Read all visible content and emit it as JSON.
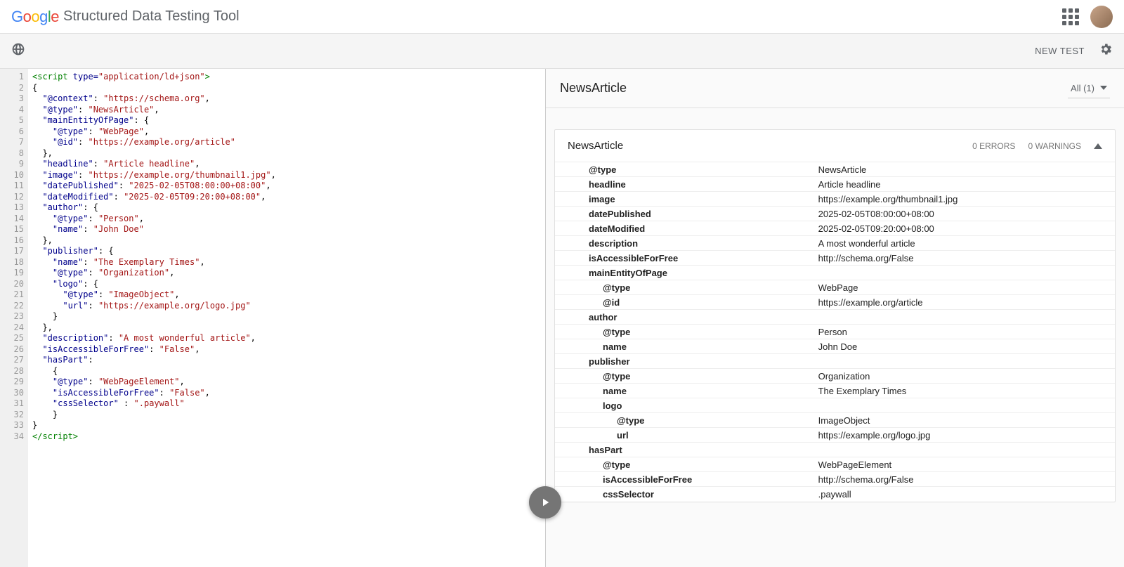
{
  "header": {
    "app_title": "Structured Data Testing Tool"
  },
  "toolbar": {
    "new_test_label": "NEW TEST"
  },
  "code": {
    "line_count": 34,
    "tokens": [
      [
        {
          "c": "t-tag",
          "t": "<script "
        },
        {
          "c": "t-attr",
          "t": "type="
        },
        {
          "c": "t-str",
          "t": "\"application/ld+json\""
        },
        {
          "c": "t-tag",
          "t": ">"
        }
      ],
      [
        {
          "c": "t-punc",
          "t": "{"
        }
      ],
      [
        {
          "c": "t-punc",
          "t": "  "
        },
        {
          "c": "t-key",
          "t": "\"@context\""
        },
        {
          "c": "t-punc",
          "t": ": "
        },
        {
          "c": "t-str",
          "t": "\"https://schema.org\""
        },
        {
          "c": "t-punc",
          "t": ","
        }
      ],
      [
        {
          "c": "t-punc",
          "t": "  "
        },
        {
          "c": "t-key",
          "t": "\"@type\""
        },
        {
          "c": "t-punc",
          "t": ": "
        },
        {
          "c": "t-str",
          "t": "\"NewsArticle\""
        },
        {
          "c": "t-punc",
          "t": ","
        }
      ],
      [
        {
          "c": "t-punc",
          "t": "  "
        },
        {
          "c": "t-key",
          "t": "\"mainEntityOfPage\""
        },
        {
          "c": "t-punc",
          "t": ": {"
        }
      ],
      [
        {
          "c": "t-punc",
          "t": "    "
        },
        {
          "c": "t-key",
          "t": "\"@type\""
        },
        {
          "c": "t-punc",
          "t": ": "
        },
        {
          "c": "t-str",
          "t": "\"WebPage\""
        },
        {
          "c": "t-punc",
          "t": ","
        }
      ],
      [
        {
          "c": "t-punc",
          "t": "    "
        },
        {
          "c": "t-key",
          "t": "\"@id\""
        },
        {
          "c": "t-punc",
          "t": ": "
        },
        {
          "c": "t-str",
          "t": "\"https://example.org/article\""
        }
      ],
      [
        {
          "c": "t-punc",
          "t": "  },"
        }
      ],
      [
        {
          "c": "t-punc",
          "t": "  "
        },
        {
          "c": "t-key",
          "t": "\"headline\""
        },
        {
          "c": "t-punc",
          "t": ": "
        },
        {
          "c": "t-str",
          "t": "\"Article headline\""
        },
        {
          "c": "t-punc",
          "t": ","
        }
      ],
      [
        {
          "c": "t-punc",
          "t": "  "
        },
        {
          "c": "t-key",
          "t": "\"image\""
        },
        {
          "c": "t-punc",
          "t": ": "
        },
        {
          "c": "t-str",
          "t": "\"https://example.org/thumbnail1.jpg\""
        },
        {
          "c": "t-punc",
          "t": ","
        }
      ],
      [
        {
          "c": "t-punc",
          "t": "  "
        },
        {
          "c": "t-key",
          "t": "\"datePublished\""
        },
        {
          "c": "t-punc",
          "t": ": "
        },
        {
          "c": "t-str",
          "t": "\"2025-02-05T08:00:00+08:00\""
        },
        {
          "c": "t-punc",
          "t": ","
        }
      ],
      [
        {
          "c": "t-punc",
          "t": "  "
        },
        {
          "c": "t-key",
          "t": "\"dateModified\""
        },
        {
          "c": "t-punc",
          "t": ": "
        },
        {
          "c": "t-str",
          "t": "\"2025-02-05T09:20:00+08:00\""
        },
        {
          "c": "t-punc",
          "t": ","
        }
      ],
      [
        {
          "c": "t-punc",
          "t": "  "
        },
        {
          "c": "t-key",
          "t": "\"author\""
        },
        {
          "c": "t-punc",
          "t": ": {"
        }
      ],
      [
        {
          "c": "t-punc",
          "t": "    "
        },
        {
          "c": "t-key",
          "t": "\"@type\""
        },
        {
          "c": "t-punc",
          "t": ": "
        },
        {
          "c": "t-str",
          "t": "\"Person\""
        },
        {
          "c": "t-punc",
          "t": ","
        }
      ],
      [
        {
          "c": "t-punc",
          "t": "    "
        },
        {
          "c": "t-key",
          "t": "\"name\""
        },
        {
          "c": "t-punc",
          "t": ": "
        },
        {
          "c": "t-str",
          "t": "\"John Doe\""
        }
      ],
      [
        {
          "c": "t-punc",
          "t": "  },"
        }
      ],
      [
        {
          "c": "t-punc",
          "t": "  "
        },
        {
          "c": "t-key",
          "t": "\"publisher\""
        },
        {
          "c": "t-punc",
          "t": ": {"
        }
      ],
      [
        {
          "c": "t-punc",
          "t": "    "
        },
        {
          "c": "t-key",
          "t": "\"name\""
        },
        {
          "c": "t-punc",
          "t": ": "
        },
        {
          "c": "t-str",
          "t": "\"The Exemplary Times\""
        },
        {
          "c": "t-punc",
          "t": ","
        }
      ],
      [
        {
          "c": "t-punc",
          "t": "    "
        },
        {
          "c": "t-key",
          "t": "\"@type\""
        },
        {
          "c": "t-punc",
          "t": ": "
        },
        {
          "c": "t-str",
          "t": "\"Organization\""
        },
        {
          "c": "t-punc",
          "t": ","
        }
      ],
      [
        {
          "c": "t-punc",
          "t": "    "
        },
        {
          "c": "t-key",
          "t": "\"logo\""
        },
        {
          "c": "t-punc",
          "t": ": {"
        }
      ],
      [
        {
          "c": "t-punc",
          "t": "      "
        },
        {
          "c": "t-key",
          "t": "\"@type\""
        },
        {
          "c": "t-punc",
          "t": ": "
        },
        {
          "c": "t-str",
          "t": "\"ImageObject\""
        },
        {
          "c": "t-punc",
          "t": ","
        }
      ],
      [
        {
          "c": "t-punc",
          "t": "      "
        },
        {
          "c": "t-key",
          "t": "\"url\""
        },
        {
          "c": "t-punc",
          "t": ": "
        },
        {
          "c": "t-str",
          "t": "\"https://example.org/logo.jpg\""
        }
      ],
      [
        {
          "c": "t-punc",
          "t": "    }"
        }
      ],
      [
        {
          "c": "t-punc",
          "t": "  },"
        }
      ],
      [
        {
          "c": "t-punc",
          "t": "  "
        },
        {
          "c": "t-key",
          "t": "\"description\""
        },
        {
          "c": "t-punc",
          "t": ": "
        },
        {
          "c": "t-str",
          "t": "\"A most wonderful article\""
        },
        {
          "c": "t-punc",
          "t": ","
        }
      ],
      [
        {
          "c": "t-punc",
          "t": "  "
        },
        {
          "c": "t-key",
          "t": "\"isAccessibleForFree\""
        },
        {
          "c": "t-punc",
          "t": ": "
        },
        {
          "c": "t-str",
          "t": "\"False\""
        },
        {
          "c": "t-punc",
          "t": ","
        }
      ],
      [
        {
          "c": "t-punc",
          "t": "  "
        },
        {
          "c": "t-key",
          "t": "\"hasPart\""
        },
        {
          "c": "t-punc",
          "t": ":"
        }
      ],
      [
        {
          "c": "t-punc",
          "t": "    {"
        }
      ],
      [
        {
          "c": "t-punc",
          "t": "    "
        },
        {
          "c": "t-key",
          "t": "\"@type\""
        },
        {
          "c": "t-punc",
          "t": ": "
        },
        {
          "c": "t-str",
          "t": "\"WebPageElement\""
        },
        {
          "c": "t-punc",
          "t": ","
        }
      ],
      [
        {
          "c": "t-punc",
          "t": "    "
        },
        {
          "c": "t-key",
          "t": "\"isAccessibleForFree\""
        },
        {
          "c": "t-punc",
          "t": ": "
        },
        {
          "c": "t-str",
          "t": "\"False\""
        },
        {
          "c": "t-punc",
          "t": ","
        }
      ],
      [
        {
          "c": "t-punc",
          "t": "    "
        },
        {
          "c": "t-key",
          "t": "\"cssSelector\""
        },
        {
          "c": "t-punc",
          "t": " : "
        },
        {
          "c": "t-str",
          "t": "\".paywall\""
        }
      ],
      [
        {
          "c": "t-punc",
          "t": "    }"
        }
      ],
      [
        {
          "c": "t-punc",
          "t": "}"
        }
      ],
      [
        {
          "c": "t-tag",
          "t": "</scr"
        },
        {
          "c": "t-tag",
          "t": "ipt>"
        }
      ]
    ]
  },
  "results": {
    "type_title": "NewsArticle",
    "filter_label": "All (1)",
    "card": {
      "title": "NewsArticle",
      "errors_label": "0 ERRORS",
      "warnings_label": "0 WARNINGS",
      "rows": [
        {
          "indent": 0,
          "key": "@type",
          "val": "NewsArticle"
        },
        {
          "indent": 0,
          "key": "headline",
          "val": "Article headline"
        },
        {
          "indent": 0,
          "key": "image",
          "val": "https://example.org/thumbnail1.jpg"
        },
        {
          "indent": 0,
          "key": "datePublished",
          "val": "2025-02-05T08:00:00+08:00"
        },
        {
          "indent": 0,
          "key": "dateModified",
          "val": "2025-02-05T09:20:00+08:00"
        },
        {
          "indent": 0,
          "key": "description",
          "val": "A most wonderful article"
        },
        {
          "indent": 0,
          "key": "isAccessibleForFree",
          "val": "http://schema.org/False"
        },
        {
          "indent": 0,
          "key": "mainEntityOfPage",
          "val": ""
        },
        {
          "indent": 1,
          "key": "@type",
          "val": "WebPage"
        },
        {
          "indent": 1,
          "key": "@id",
          "val": "https://example.org/article"
        },
        {
          "indent": 0,
          "key": "author",
          "val": ""
        },
        {
          "indent": 1,
          "key": "@type",
          "val": "Person"
        },
        {
          "indent": 1,
          "key": "name",
          "val": "John Doe"
        },
        {
          "indent": 0,
          "key": "publisher",
          "val": ""
        },
        {
          "indent": 1,
          "key": "@type",
          "val": "Organization"
        },
        {
          "indent": 1,
          "key": "name",
          "val": "The Exemplary Times"
        },
        {
          "indent": 1,
          "key": "logo",
          "val": ""
        },
        {
          "indent": 2,
          "key": "@type",
          "val": "ImageObject"
        },
        {
          "indent": 2,
          "key": "url",
          "val": "https://example.org/logo.jpg"
        },
        {
          "indent": 0,
          "key": "hasPart",
          "val": ""
        },
        {
          "indent": 1,
          "key": "@type",
          "val": "WebPageElement"
        },
        {
          "indent": 1,
          "key": "isAccessibleForFree",
          "val": "http://schema.org/False"
        },
        {
          "indent": 1,
          "key": "cssSelector",
          "val": ".paywall"
        }
      ]
    }
  }
}
